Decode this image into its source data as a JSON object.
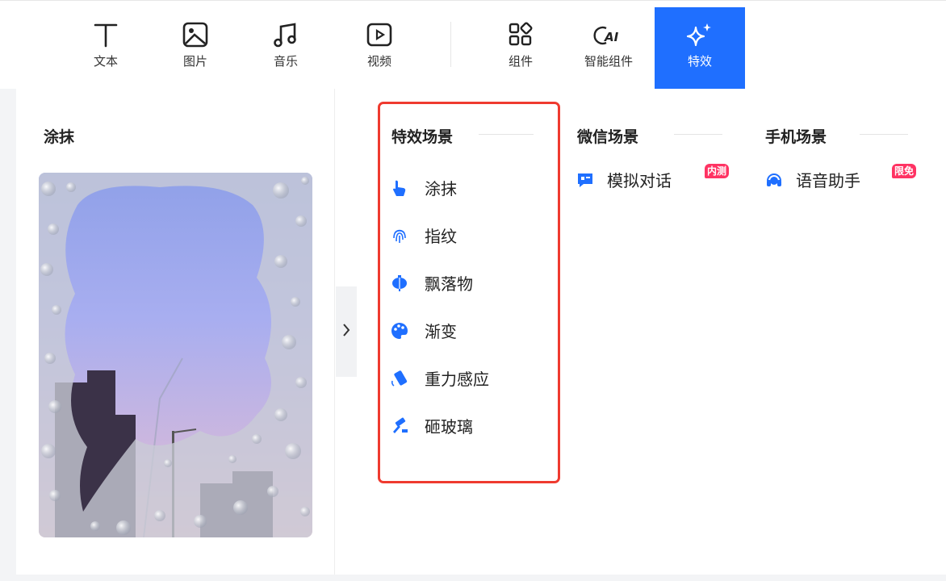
{
  "toolbar": {
    "items": [
      {
        "label": "文本",
        "icon": "text-icon"
      },
      {
        "label": "图片",
        "icon": "image-icon"
      },
      {
        "label": "音乐",
        "icon": "music-icon"
      },
      {
        "label": "视频",
        "icon": "video-icon"
      },
      {
        "label": "组件",
        "icon": "components-icon"
      },
      {
        "label": "智能组件",
        "icon": "ai-icon"
      },
      {
        "label": "特效",
        "icon": "sparkle-icon",
        "active": true
      }
    ],
    "active_color": "#1f6fff"
  },
  "left_pane": {
    "title": "涂抹"
  },
  "sections": {
    "effects": {
      "title": "特效场景",
      "items": [
        {
          "label": "涂抹",
          "icon": "hand-pointer-icon"
        },
        {
          "label": "指纹",
          "icon": "fingerprint-icon"
        },
        {
          "label": "飘落物",
          "icon": "lantern-icon"
        },
        {
          "label": "渐变",
          "icon": "palette-icon"
        },
        {
          "label": "重力感应",
          "icon": "phone-tilt-icon"
        },
        {
          "label": "砸玻璃",
          "icon": "hammer-icon"
        }
      ]
    },
    "wechat": {
      "title": "微信场景",
      "items": [
        {
          "label": "模拟对话",
          "icon": "chat-icon",
          "badge": "内测"
        }
      ]
    },
    "phone": {
      "title": "手机场景",
      "items": [
        {
          "label": "语音助手",
          "icon": "headset-icon",
          "badge": "限免"
        }
      ]
    }
  },
  "colors": {
    "accent": "#1f6fff",
    "highlight_border": "#ef3a2f",
    "badge": "#ff3363"
  }
}
